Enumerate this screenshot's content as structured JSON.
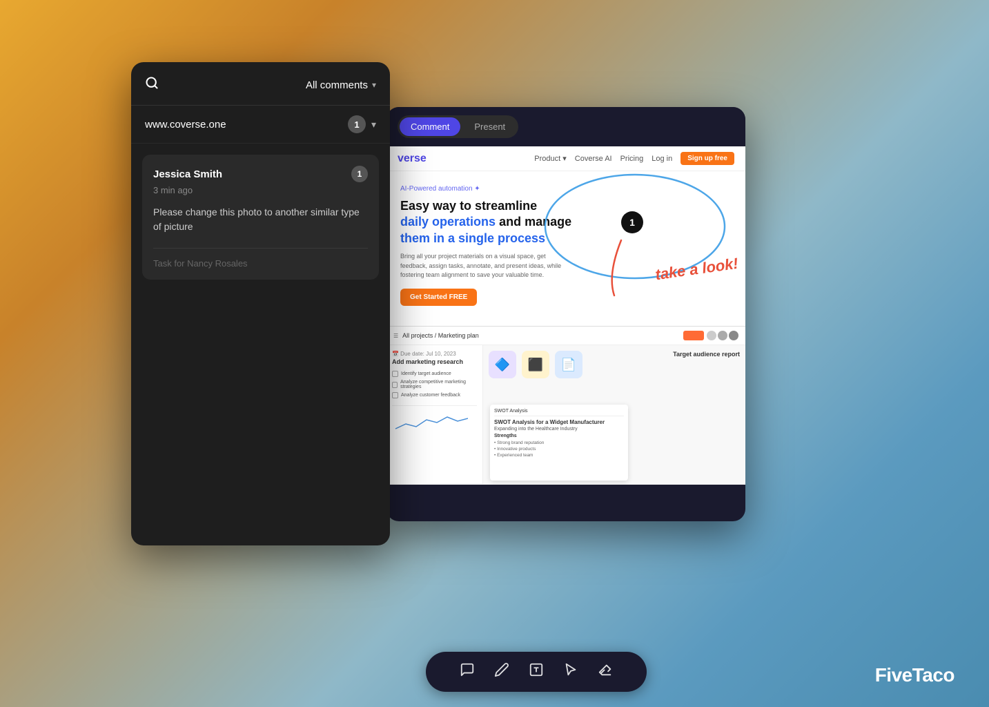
{
  "background": {
    "gradient_start": "#E8A830",
    "gradient_end": "#4A8CB0"
  },
  "comments_panel": {
    "header": {
      "search_icon": "🔍",
      "filter_label": "All comments",
      "chevron": "▾"
    },
    "url_row": {
      "url": "www.coverse.one",
      "count": "1",
      "chevron": "▾"
    },
    "comment": {
      "author": "Jessica Smith",
      "time_ago": "3 min ago",
      "badge_count": "1",
      "text": "Please change this photo to another similar type of picture",
      "task_label": "Task for Nancy Rosales"
    }
  },
  "browser_panel": {
    "tabs": [
      {
        "label": "Comment",
        "active": true
      },
      {
        "label": "Present",
        "active": false
      }
    ],
    "webpage": {
      "logo": "verse",
      "nav_links": [
        "Product ▾",
        "Coverse AI",
        "Pricing",
        "Log in"
      ],
      "signup_label": "Sign up free",
      "ai_badge": "AI-Powered automation ✦",
      "hero_title_line1": "Easy way to streamline",
      "hero_title_line2": "daily operations",
      "hero_title_line3": "and manage",
      "hero_title_line4": "them in a single process",
      "description": "Bring all your project materials on a visual space, get feedback, assign tasks, annotate, and present ideas, while fostering team alignment to save your valuable time.",
      "cta_label": "Get Started FREE"
    },
    "annotation": {
      "number": "1",
      "handwriting": "take a look!"
    }
  },
  "second_panel": {
    "header_title": "All projects / Marketing plan",
    "task_section": {
      "date_label": "Due date: Jul 10, 2023",
      "title": "Add marketing research",
      "items": [
        "Identify target audience",
        "Analyze competitive marketing strategies",
        "Analyze customer feedback"
      ]
    },
    "target_audience_label": "Target audience report"
  },
  "toolbar": {
    "icons": [
      "💬",
      "✏️",
      "▣",
      "↖",
      "◇"
    ]
  },
  "branding": {
    "name_part1": "Five",
    "name_part2": "Taco"
  }
}
